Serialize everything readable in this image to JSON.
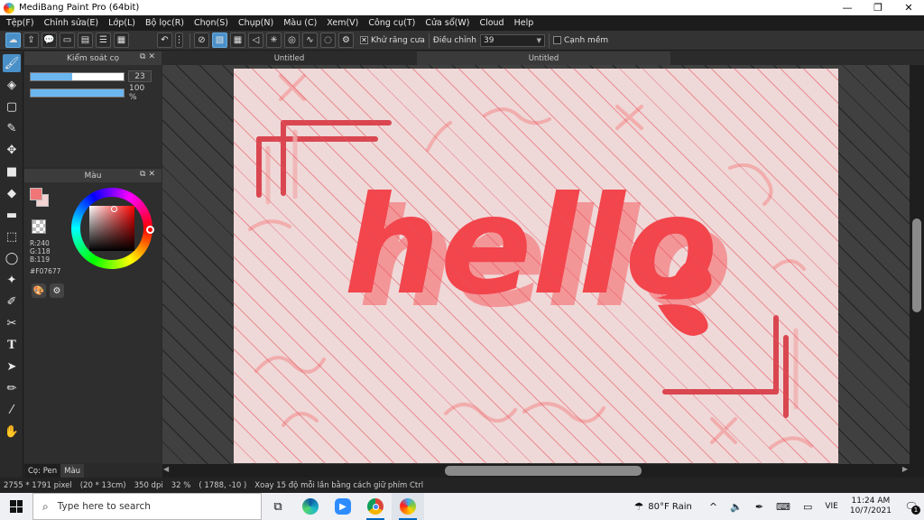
{
  "window": {
    "title": "MediBang Paint Pro (64bit)",
    "minimize_label": "—",
    "maximize_label": "❐",
    "close_label": "✕"
  },
  "menu": [
    "Tệp(F)",
    "Chỉnh sửa(E)",
    "Lớp(L)",
    "Bộ lọc(R)",
    "Chọn(S)",
    "Chụp(N)",
    "Màu (C)",
    "Xem(V)",
    "Công cụ(T)",
    "Cửa sổ(W)",
    "Cloud",
    "Help"
  ],
  "toolbar": {
    "antialias_label": "Khử răng cưa",
    "antialias_checked": "✕",
    "adjust_label": "Điều chỉnh",
    "adjust_value": "39",
    "edge_label": "Cạnh mềm"
  },
  "brush_panel": {
    "title": "Kiểm soát cọ",
    "size_value": "23",
    "size_fill_percent": 45,
    "opacity_value": "100 %",
    "opacity_fill_percent": 100
  },
  "color_panel": {
    "title": "Màu",
    "r": "R:240",
    "g": "G:118",
    "b": "B:119",
    "hex": "#F07677",
    "foreground_color": "#f07677",
    "background_color": "#f3d3d3"
  },
  "panel_tabs": [
    "Cọ: Pen",
    "Màu"
  ],
  "doc_tabs": [
    "Untitled",
    "Untitled"
  ],
  "canvas": {
    "artwork_text": "hello",
    "paper_color": "#efd8d8",
    "accent_color": "#f2454c"
  },
  "status": {
    "pixels": "2755 * 1791 pixel",
    "size_cm": "(20 * 13cm)",
    "dpi": "350 dpi",
    "zoom": "32 %",
    "coords": "( 1788, -10 )",
    "hint": "Xoay 15 độ mỗi lần bằng cách giữ phím Ctrl"
  },
  "taskbar": {
    "search_placeholder": "Type here to search",
    "weather_temp": "80°F",
    "weather_text": "Rain",
    "language": "VIE",
    "time": "11:24 AM",
    "date": "10/7/2021",
    "notification_count": "1"
  }
}
